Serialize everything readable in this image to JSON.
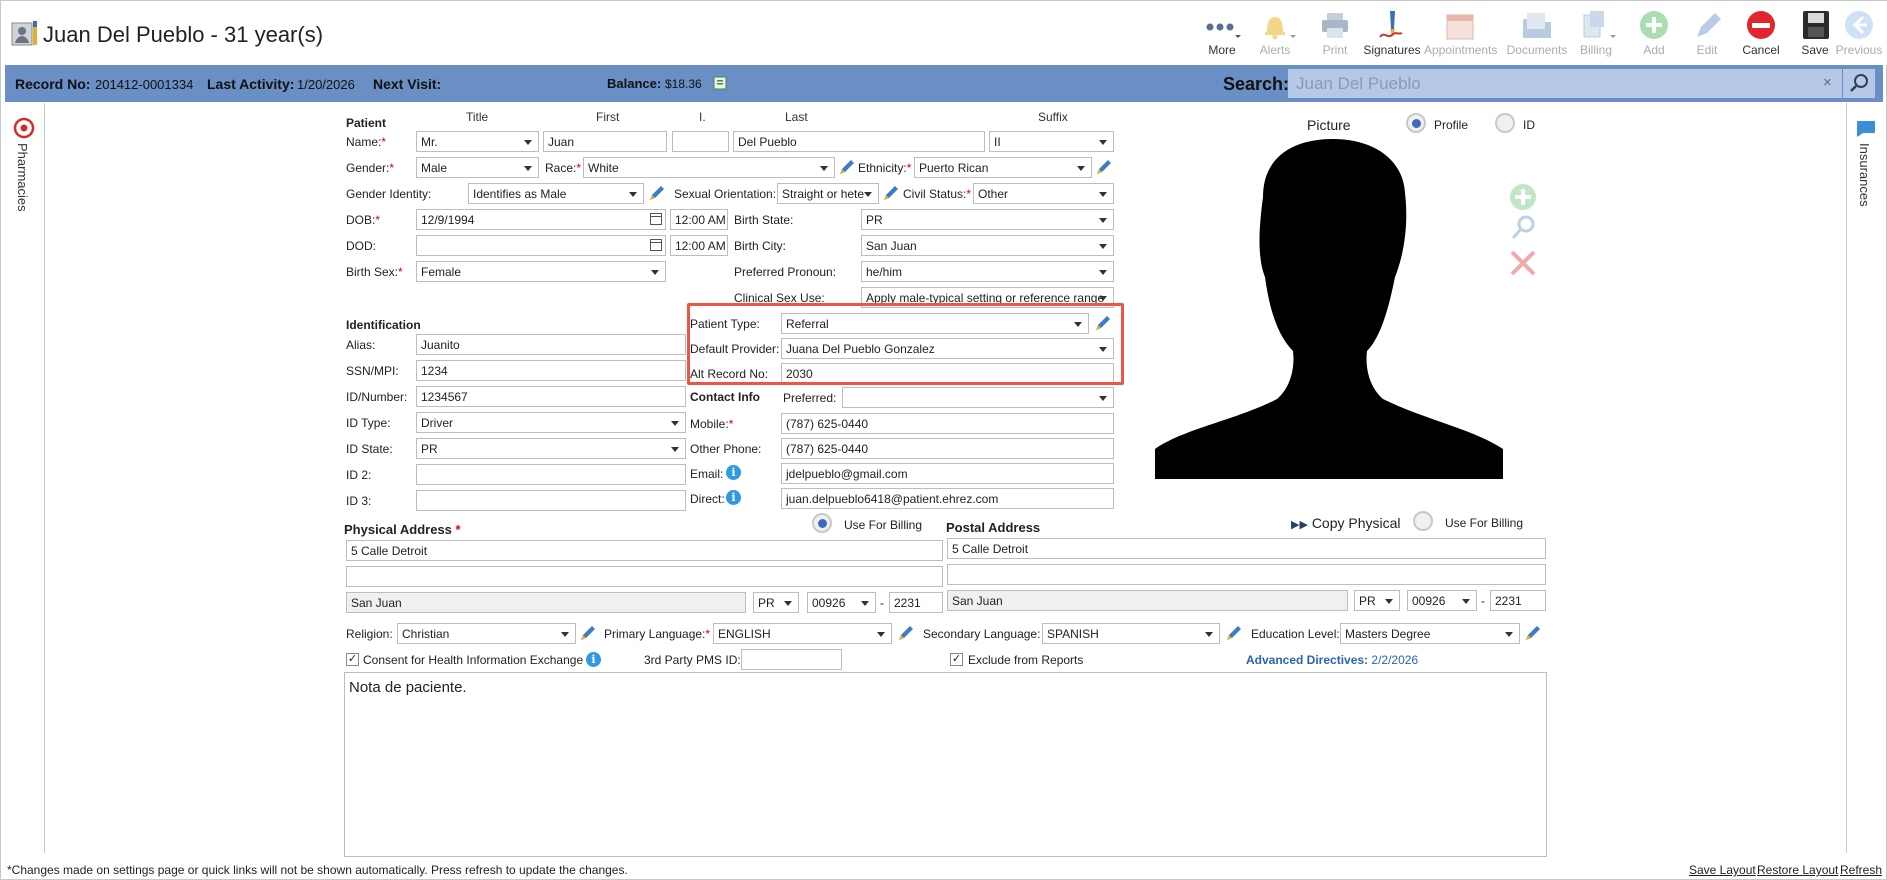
{
  "window": {
    "title": "Juan Del Pueblo - 31 year(s)"
  },
  "toolbar": {
    "more": "More",
    "alerts": "Alerts",
    "print": "Print",
    "signatures": "Signatures",
    "appointments": "Appointments",
    "documents": "Documents",
    "billing": "Billing",
    "add": "Add",
    "edit": "Edit",
    "cancel": "Cancel",
    "save": "Save",
    "previous": "Previous"
  },
  "infobar": {
    "record_label": "Record No:",
    "record_value": "201412-0001334",
    "last_activity_label": "Last Activity:",
    "last_activity_value": "1/20/2026",
    "next_visit_label": "Next Visit:",
    "balance_label": "Balance:",
    "balance_value": "$18.36",
    "search_label": "Search:",
    "search_value": "Juan Del Pueblo",
    "search_clear": "×"
  },
  "rails": {
    "left": "Pharmacies",
    "right": "Insurances"
  },
  "patient": {
    "section": "Patient",
    "col_title": "Title",
    "col_first": "First",
    "col_initial": "I.",
    "col_last": "Last",
    "col_suffix": "Suffix",
    "name_label": "Name:",
    "title": "Mr.",
    "first": "Juan",
    "initial": "",
    "last": "Del Pueblo",
    "suffix": "II",
    "gender_label": "Gender:",
    "gender": "Male",
    "race_label": "Race:",
    "race": "White",
    "ethnicity_label": "Ethnicity:",
    "ethnicity": "Puerto Rican",
    "gender_identity_label": "Gender Identity:",
    "gender_identity": "Identifies as Male",
    "sexual_orientation_label": "Sexual Orientation:",
    "sexual_orientation": "Straight or hete",
    "civil_status_label": "Civil Status:",
    "civil_status": "Other",
    "dob_label": "DOB:",
    "dob": "12/9/1994",
    "dob_time": "12:00 AM",
    "birth_state_label": "Birth State:",
    "birth_state": "PR",
    "dod_label": "DOD:",
    "dod": "",
    "dod_time": "12:00 AM",
    "birth_city_label": "Birth City:",
    "birth_city": "San Juan",
    "birth_sex_label": "Birth Sex:",
    "birth_sex": "Female",
    "pronoun_label": "Preferred Pronoun:",
    "pronoun": "he/him",
    "clinical_sex_label": "Clinical Sex Use:",
    "clinical_sex": "Apply male-typical setting or reference range"
  },
  "identification": {
    "section": "Identification",
    "alias_label": "Alias:",
    "alias": "Juanito",
    "ssn_label": "SSN/MPI:",
    "ssn": "1234",
    "idnum_label": "ID/Number:",
    "idnum": "1234567",
    "idtype_label": "ID Type:",
    "idtype": "Driver",
    "idstate_label": "ID State:",
    "idstate": "PR",
    "id2_label": "ID 2:",
    "id2": "",
    "id3_label": "ID 3:",
    "id3": "",
    "patient_type_label": "Patient Type:",
    "patient_type": "Referral",
    "default_provider_label": "Default Provider:",
    "default_provider": "Juana Del Pueblo Gonzalez",
    "alt_record_label": "Alt Record No:",
    "alt_record": "2030"
  },
  "contact": {
    "section": "Contact Info",
    "preferred_label": "Preferred:",
    "preferred": "",
    "mobile_label": "Mobile:",
    "mobile": "(787) 625-0440",
    "other_phone_label": "Other Phone:",
    "other_phone": "(787) 625-0440",
    "email_label": "Email:",
    "email": "jdelpueblo@gmail.com",
    "direct_label": "Direct:",
    "direct": "juan.delpueblo6418@patient.ehrez.com"
  },
  "picture": {
    "label": "Picture",
    "profile": "Profile",
    "id": "ID"
  },
  "physical": {
    "section": "Physical Address",
    "req": "*",
    "use_for_billing": "Use For Billing",
    "line1": "5 Calle Detroit",
    "line2": "",
    "city": "San Juan",
    "state": "PR",
    "zip": "00926",
    "zip4": "2231",
    "dash": "-"
  },
  "postal": {
    "section": "Postal Address",
    "copy": "Copy Physical",
    "use_for_billing": "Use For Billing",
    "line1": "5 Calle Detroit",
    "line2": "",
    "city": "San Juan",
    "state": "PR",
    "zip": "00926",
    "zip4": "2231",
    "dash": "-"
  },
  "misc": {
    "religion_label": "Religion:",
    "religion": "Christian",
    "primary_lang_label": "Primary Language:",
    "primary_lang": "ENGLISH",
    "secondary_lang_label": "Secondary Language:",
    "secondary_lang": "SPANISH",
    "education_label": "Education Level:",
    "education": "Masters Degree",
    "consent_label": "Consent for Health Information Exchange",
    "pms_label": "3rd Party PMS ID:",
    "pms": "",
    "exclude_label": "Exclude from Reports",
    "adv_label": "Advanced Directives:",
    "adv_value": "2/2/2026",
    "notes": "Nota de paciente."
  },
  "footer": {
    "note": "*Changes made on settings page or quick links will not be shown automatically. Press refresh to update the changes.",
    "save_layout": "Save Layout",
    "restore_layout": "Restore Layout",
    "refresh": "Refresh"
  },
  "colors": {
    "infobar": "#6a8fc4",
    "highlight": "#e8574a",
    "accent": "#3a6cc0"
  }
}
